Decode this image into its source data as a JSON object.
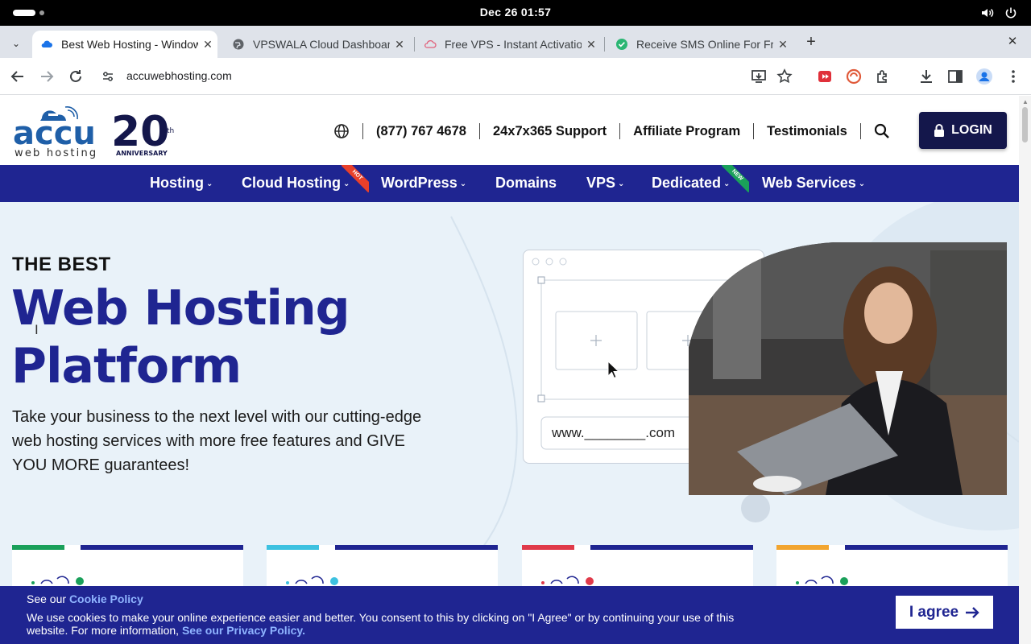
{
  "os": {
    "clock": "Dec 26  01:57"
  },
  "tabs": [
    {
      "label": "Best Web Hosting - Windows",
      "active": true
    },
    {
      "label": "VPSWALA Cloud Dashboard"
    },
    {
      "label": "Free VPS - Instant Activation"
    },
    {
      "label": "Receive SMS Online For Free"
    }
  ],
  "browser": {
    "url": "accuwebhosting.com"
  },
  "header": {
    "logo_text": "accu",
    "logo_sub": "web hosting",
    "logo_num": "20",
    "logo_th": "th",
    "logo_anniv": "ANNIVERSARY",
    "phone": "(877) 767 4678",
    "support": "24x7x365 Support",
    "affiliate": "Affiliate Program",
    "testimonials": "Testimonials",
    "login": "LOGIN"
  },
  "nav": {
    "items": [
      {
        "label": "Hosting"
      },
      {
        "label": "Cloud Hosting",
        "badge": "HOT"
      },
      {
        "label": "WordPress"
      },
      {
        "label": "Domains"
      },
      {
        "label": "VPS"
      },
      {
        "label": "Dedicated",
        "badge": "NEW"
      },
      {
        "label": "Web Services"
      }
    ]
  },
  "hero": {
    "kicker": "THE BEST",
    "title_line1": "Web Hosting",
    "title_line2": "Platform",
    "subtitle": "Take your business to the next level with our cutting-edge web hosting services with more free features and GIVE YOU MORE guarantees!",
    "domain_field": "www.________.com"
  },
  "cards": [
    {
      "accent": "#1aa05a"
    },
    {
      "accent": "#3dc1e0"
    },
    {
      "accent": "#e03a4a"
    },
    {
      "accent": "#f2a530"
    }
  ],
  "cookie": {
    "title_prefix": "See our ",
    "title_link": "Cookie Policy",
    "body": "We use cookies to make your online experience easier and better. You consent to this by clicking on \"I Agree\" or by continuing your use of this website. For more information, ",
    "body_link": "See our Privacy Policy.",
    "agree": "I agree"
  },
  "colors": {
    "brand": "#1f2591",
    "login_bg": "#14174b",
    "hero_bg": "#e9f2f9"
  }
}
